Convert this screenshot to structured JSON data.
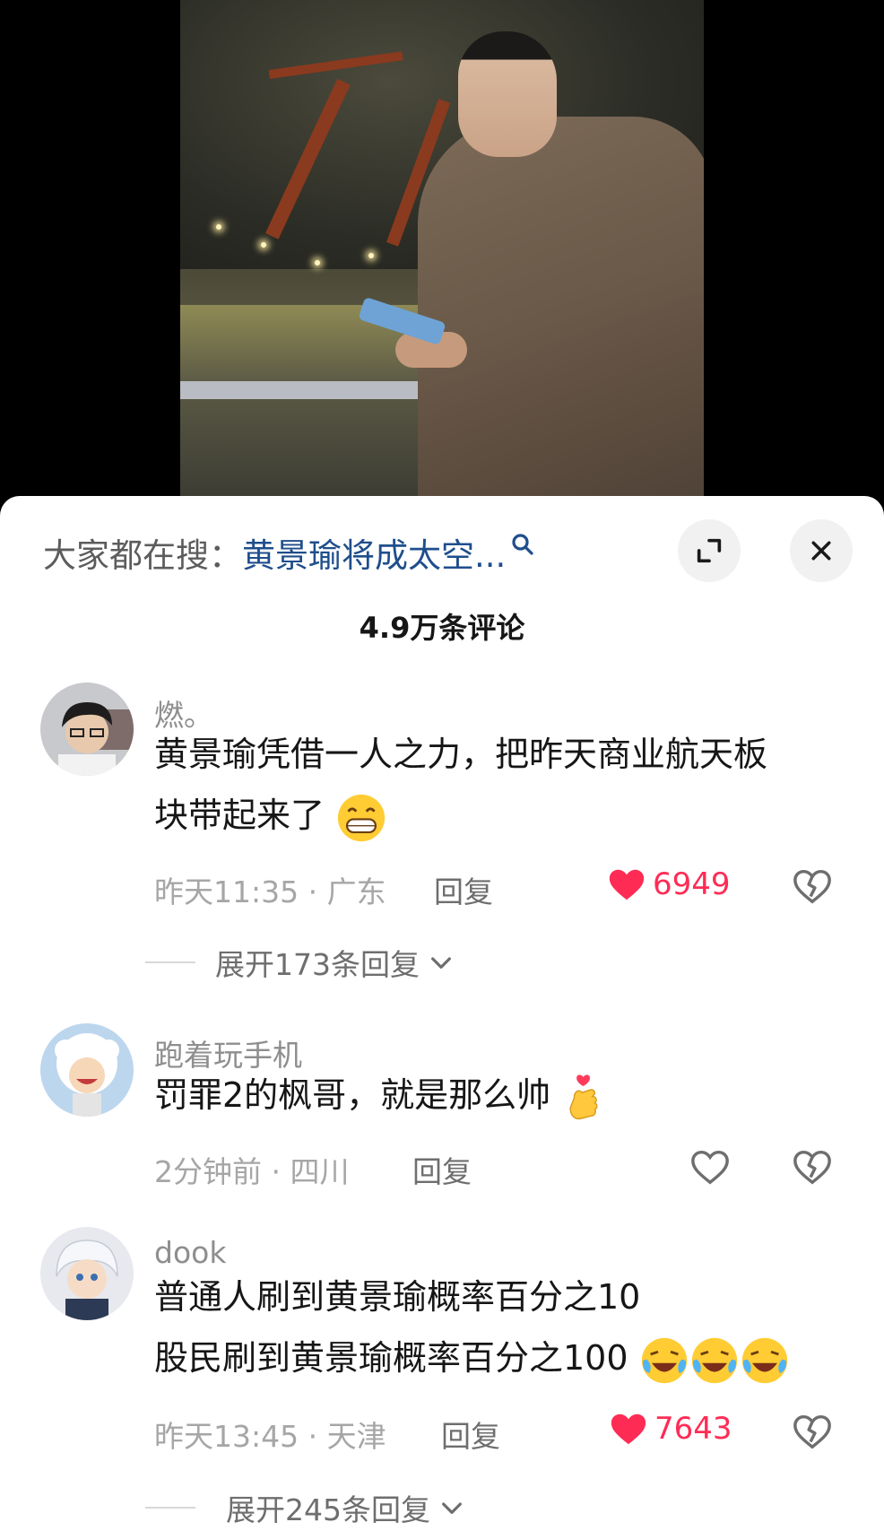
{
  "search": {
    "label": "大家都在搜：",
    "term": "黄景瑜将成太空..."
  },
  "comments_header": {
    "title": "4.9万条评论"
  },
  "comments": [
    {
      "user": "燃。",
      "text_line1": "黄景瑜凭借一人之力，把昨天商业航天板",
      "text_line2": "块带起来了",
      "emoji": [
        "grin-emoji"
      ],
      "time": "昨天11:35",
      "location": "广东",
      "reply_label": "回复",
      "likes": "6949",
      "liked": true,
      "expand_label": "展开173条回复"
    },
    {
      "user": "跑着玩手机",
      "text_line1": "罚罪2的枫哥，就是那么帅",
      "emoji": [
        "finger-heart-emoji"
      ],
      "time": "2分钟前",
      "location": "四川",
      "reply_label": "回复",
      "liked": false
    },
    {
      "user": "dook",
      "text_line1": "普通人刷到黄景瑜概率百分之10",
      "text_line2": "股民刷到黄景瑜概率百分之100",
      "emoji": [
        "laughing-crying-emoji",
        "laughing-crying-emoji",
        "laughing-crying-emoji"
      ],
      "time": "昨天13:45",
      "location": "天津",
      "reply_label": "回复",
      "likes": "7643",
      "liked": true,
      "expand_label": "展开245条回复"
    }
  ],
  "meta_separator": " · ",
  "colors": {
    "like": "#fe2c55",
    "search_term": "#1f4e8c",
    "meta": "#a6a6a6"
  }
}
